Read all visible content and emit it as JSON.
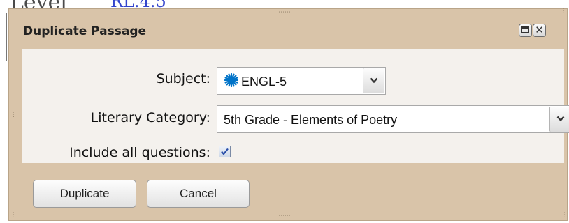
{
  "background": {
    "level_text": "Level",
    "link_text": "RL.4.5"
  },
  "dialog": {
    "title": "Duplicate Passage",
    "restore_icon": "restore-window-icon",
    "close_icon": "close-icon",
    "close_glyph": "✕"
  },
  "form": {
    "subject_label": "Subject:",
    "subject_value": "ENGL-5",
    "subject_icon": "asterisk-star-icon",
    "subject_icon_color": "#0073c8",
    "literary_label": "Literary Category:",
    "literary_value": "5th Grade - Elements of Poetry",
    "include_label": "Include all questions:",
    "include_checked": true
  },
  "buttons": {
    "duplicate": "Duplicate",
    "cancel": "Cancel"
  },
  "colors": {
    "dialog_frame": "#d9c4a9",
    "dialog_body": "#f4f1ed",
    "link": "#3344cc"
  }
}
